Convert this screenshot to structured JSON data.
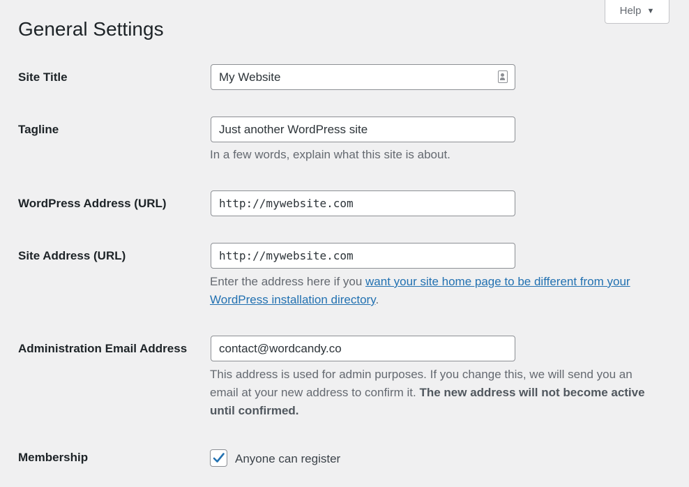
{
  "header": {
    "title": "General Settings",
    "help_label": "Help",
    "help_arrow": "▼"
  },
  "fields": {
    "site_title": {
      "label": "Site Title",
      "value": "My Website"
    },
    "tagline": {
      "label": "Tagline",
      "value": "Just another WordPress site",
      "description": "In a few words, explain what this site is about."
    },
    "wp_address": {
      "label": "WordPress Address (URL)",
      "value": "http://mywebsite.com"
    },
    "site_address": {
      "label": "Site Address (URL)",
      "value": "http://mywebsite.com",
      "description_prefix": "Enter the address here if you ",
      "description_link": "want your site home page to be different from your WordPress installation directory",
      "description_suffix": "."
    },
    "admin_email": {
      "label": "Administration Email Address",
      "value": "contact@wordcandy.co",
      "description": "This address is used for admin purposes. If you change this, we will send you an email at your new address to confirm it. ",
      "description_bold": "The new address will not become active until confirmed."
    },
    "membership": {
      "label": "Membership",
      "checkbox_label": "Anyone can register",
      "checked": true
    }
  },
  "colors": {
    "background": "#f0f0f1",
    "link": "#2271b1",
    "checkbox_accent": "#2271b1"
  },
  "icons": {
    "site_title_field_icon": "contact-card-icon",
    "help_dropdown_icon": "triangle-down-icon",
    "checkbox_icon": "checkmark-icon"
  }
}
